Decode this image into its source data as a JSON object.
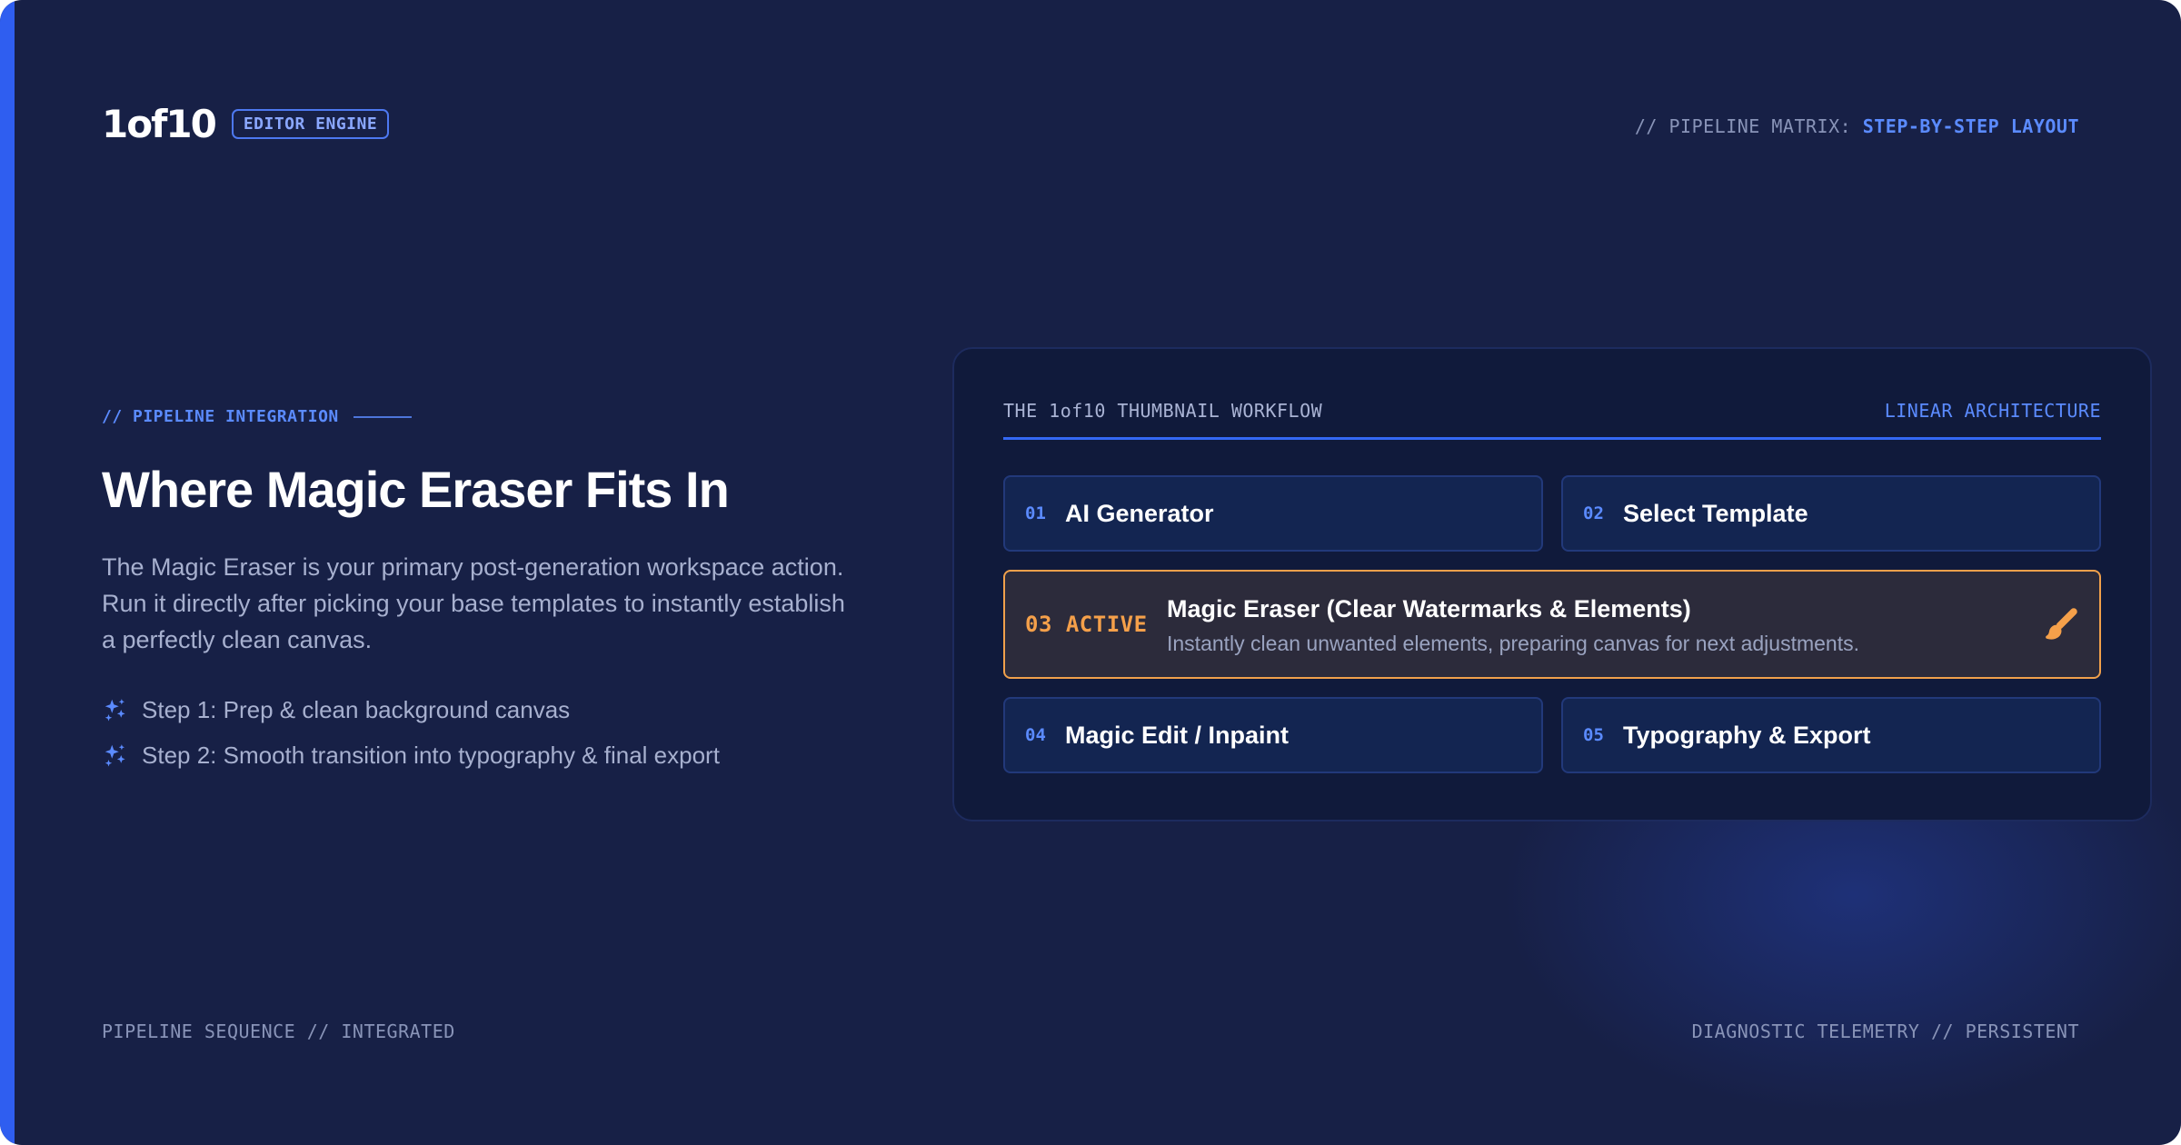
{
  "header": {
    "logo": "1of10",
    "badge": "EDITOR ENGINE",
    "matrix_prefix": "// PIPELINE MATRIX:",
    "matrix_value": "STEP-BY-STEP LAYOUT"
  },
  "intro": {
    "eyebrow": "// PIPELINE INTEGRATION",
    "title": "Where Magic Eraser Fits In",
    "description": "The Magic Eraser is your primary post-generation workspace action. Run it directly after picking your base templates to instantly establish a perfectly clean canvas.",
    "steps": [
      {
        "text": "Step 1: Prep & clean background canvas",
        "icon": "sparkle-icon"
      },
      {
        "text": "Step 2: Smooth transition into typography & final export",
        "icon": "sparkle-icon"
      }
    ]
  },
  "workflow": {
    "heading": "THE 1of10 THUMBNAIL WORKFLOW",
    "architecture": "LINEAR ARCHITECTURE",
    "steps": [
      {
        "num": "01",
        "label": "AI Generator"
      },
      {
        "num": "02",
        "label": "Select Template"
      },
      {
        "num": "03",
        "status": "ACTIVE",
        "label": "Magic Eraser (Clear Watermarks & Elements)",
        "description": "Instantly clean unwanted elements, preparing canvas for next adjustments.",
        "icon": "brush-icon"
      },
      {
        "num": "04",
        "label": "Magic Edit / Inpaint"
      },
      {
        "num": "05",
        "label": "Typography & Export"
      }
    ]
  },
  "footer": {
    "left": "PIPELINE SEQUENCE // INTEGRATED",
    "right": "DIAGNOSTIC TELEMETRY // PERSISTENT"
  },
  "colors": {
    "background": "#172046",
    "accent": "#5b8bff",
    "active": "#f5a04a"
  }
}
